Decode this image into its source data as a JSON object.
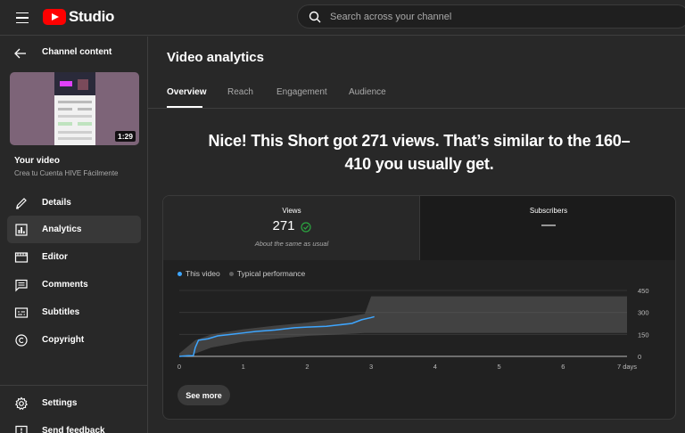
{
  "app": {
    "name": "Studio"
  },
  "search": {
    "placeholder": "Search across your channel"
  },
  "sidebar": {
    "back_title": "Channel content",
    "thumbnail": {
      "duration": "1:29"
    },
    "your_video_label": "Your video",
    "video_title": "Crea tu Cuenta HIVE Fácilmente",
    "items": [
      {
        "label": "Details",
        "icon": "pencil-icon",
        "active": false
      },
      {
        "label": "Analytics",
        "icon": "bar-chart-icon",
        "active": true
      },
      {
        "label": "Editor",
        "icon": "film-strip-icon",
        "active": false
      },
      {
        "label": "Comments",
        "icon": "comment-icon",
        "active": false
      },
      {
        "label": "Subtitles",
        "icon": "subtitles-icon",
        "active": false
      },
      {
        "label": "Copyright",
        "icon": "copyright-icon",
        "active": false
      }
    ],
    "bottom_items": [
      {
        "label": "Settings",
        "icon": "gear-icon"
      },
      {
        "label": "Send feedback",
        "icon": "feedback-icon"
      }
    ]
  },
  "main": {
    "title": "Video analytics",
    "tabs": [
      {
        "label": "Overview",
        "active": true
      },
      {
        "label": "Reach",
        "active": false
      },
      {
        "label": "Engagement",
        "active": false
      },
      {
        "label": "Audience",
        "active": false
      }
    ],
    "headline_line1": "Nice! This Short got 271 views. That’s similar to the 160–",
    "headline_line2": "410 you usually get.",
    "stats": {
      "views": {
        "label": "Views",
        "value": "271",
        "note": "About the same as usual",
        "status_icon": "check-circle-icon"
      },
      "subscribers": {
        "label": "Subscribers",
        "value": "—"
      }
    },
    "see_more": "See more"
  },
  "colors": {
    "accent_line": "#3ea6ff",
    "typical_band": "#3d3d3d",
    "check_green": "#2ba640",
    "brand_red": "#ff0000"
  },
  "chart_data": {
    "type": "line",
    "xlabel": "",
    "ylabel": "",
    "x_ticks": [
      "0",
      "1",
      "2",
      "3",
      "4",
      "5",
      "6",
      "7 days"
    ],
    "y_ticks": [
      "0",
      "150",
      "300",
      "450"
    ],
    "xlim": [
      0,
      7
    ],
    "ylim": [
      0,
      450
    ],
    "grid": true,
    "legend_position": "top-left",
    "series": [
      {
        "name": "This video",
        "color": "#3ea6ff",
        "x": [
          0,
          0.15,
          0.22,
          0.25,
          0.3,
          0.45,
          0.6,
          0.8,
          1.0,
          1.2,
          1.5,
          1.8,
          2.0,
          2.3,
          2.5,
          2.7,
          2.85,
          3.0,
          3.05
        ],
        "y": [
          0,
          5,
          5,
          60,
          110,
          120,
          140,
          150,
          160,
          170,
          180,
          195,
          200,
          205,
          215,
          225,
          250,
          265,
          271
        ]
      },
      {
        "name": "Typical performance",
        "color": "#5f5f5f",
        "type": "band",
        "x": [
          0,
          0.25,
          0.5,
          1.0,
          1.5,
          2.0,
          2.5,
          2.9,
          3.0,
          3.5,
          4.0,
          5.0,
          6.0,
          7.0
        ],
        "upper": [
          20,
          110,
          150,
          185,
          210,
          230,
          260,
          290,
          410,
          410,
          410,
          410,
          410,
          410
        ],
        "lower": [
          0,
          20,
          60,
          100,
          120,
          140,
          150,
          160,
          160,
          160,
          160,
          160,
          160,
          160
        ]
      }
    ]
  }
}
